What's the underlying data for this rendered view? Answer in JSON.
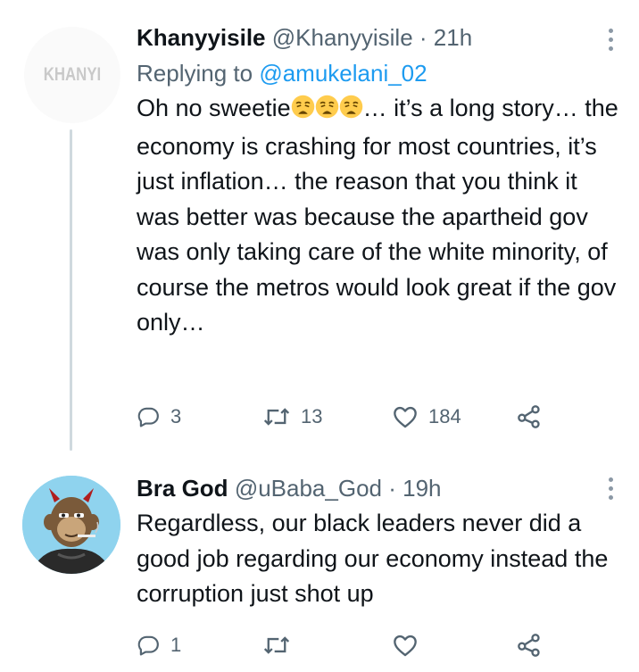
{
  "tweets": [
    {
      "name": "Khanyyisile",
      "handle": "@Khanyyisile",
      "separator": "·",
      "time": "21h",
      "replying_prefix": "Replying to",
      "replying_handle": "@amukelani_02",
      "avatar_text": "KHANYI",
      "text_before_emoji": "Oh no sweetie",
      "emoji_icon": "weary-face-emoji",
      "text_after_emoji": "… it’s a long story… the economy is crashing for most countries, it’s just inflation… the reason that you think it was better was because the apartheid gov was only taking care of the white minority, of course the metros would look great if the gov only…",
      "replies": "3",
      "retweets": "13",
      "likes": "184"
    },
    {
      "name": "Bra God",
      "handle": "@uBaba_God",
      "separator": "·",
      "time": "19h",
      "text": "Regardless, our black leaders never did a good job regarding our economy instead the corruption just shot up",
      "replies": "1",
      "retweets": "",
      "likes": ""
    }
  ],
  "colors": {
    "text": "#0f1419",
    "muted": "#536471",
    "link": "#1d9bf0",
    "thread_line": "#cfd9de"
  },
  "icons": [
    "reply-icon",
    "retweet-icon",
    "like-icon",
    "share-icon",
    "more-icon"
  ]
}
